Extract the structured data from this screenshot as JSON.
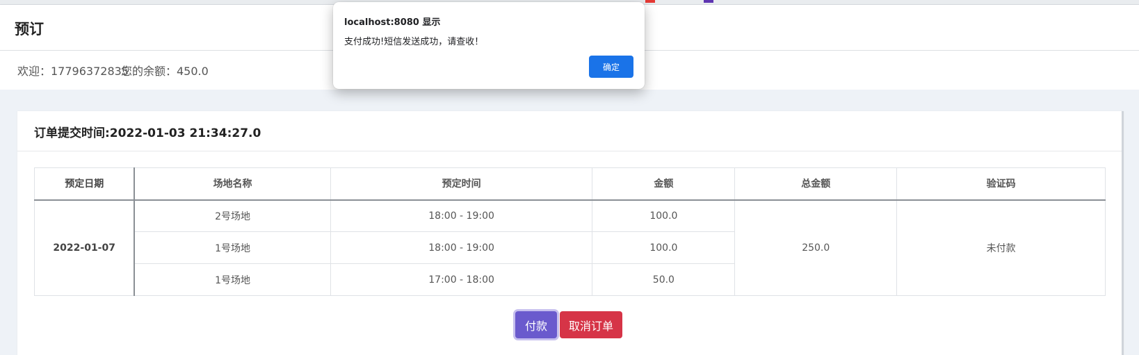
{
  "header": {
    "title": "预订"
  },
  "welcome": {
    "greeting": "欢迎：17796372835",
    "balance": "您的余额：450.0"
  },
  "order": {
    "submit_time": "订单提交时间:2022-01-03 21:34:27.0",
    "columns": [
      "预定日期",
      "场地名称",
      "预定时间",
      "金额",
      "总金额",
      "验证码"
    ],
    "date": "2022-01-07",
    "rows": [
      {
        "venue": "2号场地",
        "time": "18:00 - 19:00",
        "amount": "100.0"
      },
      {
        "venue": "1号场地",
        "time": "18:00 - 19:00",
        "amount": "100.0"
      },
      {
        "venue": "1号场地",
        "time": "17:00 - 18:00",
        "amount": "50.0"
      }
    ],
    "total": "250.0",
    "code": "未付款"
  },
  "actions": {
    "pay_label": "付款",
    "cancel_label": "取消订单"
  },
  "dialog": {
    "origin": "localhost:8080 显示",
    "message": "支付成功!短信发送成功，请查收！",
    "ok_label": "确定"
  },
  "colors": {
    "pay": "#6a5acd",
    "cancel": "#d63447",
    "dialog_ok": "#1a73e8",
    "background": "#eef2f7"
  }
}
